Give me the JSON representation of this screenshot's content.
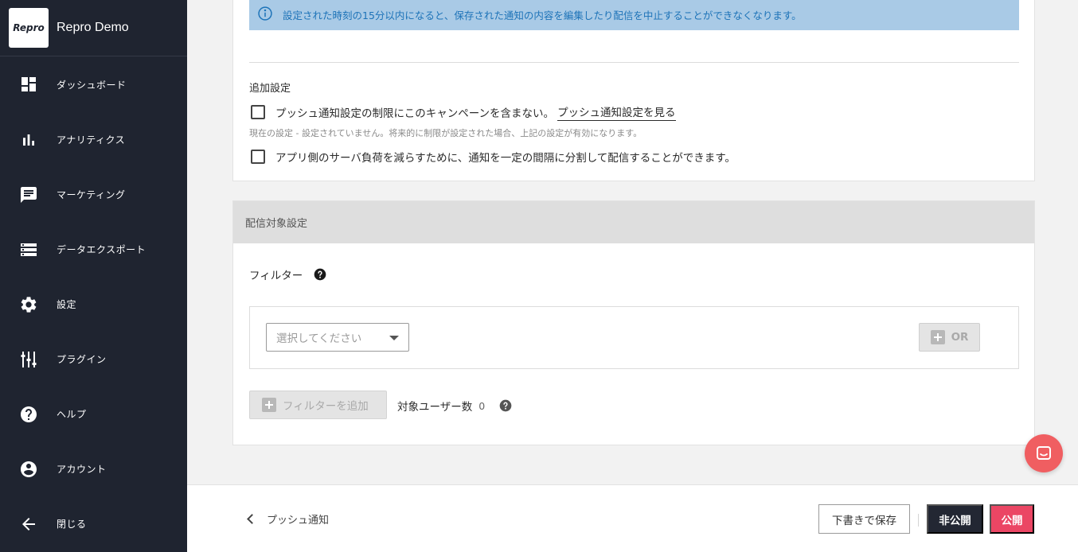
{
  "app": {
    "logo_text": "Repro",
    "name": "Repro Demo"
  },
  "sidebar": {
    "items": [
      {
        "label": "ダッシュボード",
        "icon": "dashboard-icon"
      },
      {
        "label": "アナリティクス",
        "icon": "bar-chart-icon"
      },
      {
        "label": "マーケティング",
        "icon": "message-icon"
      },
      {
        "label": "データエクスポート",
        "icon": "storage-icon"
      },
      {
        "label": "設定",
        "icon": "gear-icon"
      },
      {
        "label": "プラグイン",
        "icon": "plugin-icon"
      },
      {
        "label": "ヘルプ",
        "icon": "help-icon"
      },
      {
        "label": "アカウント",
        "icon": "account-icon"
      },
      {
        "label": "閉じる",
        "icon": "arrow-left-icon"
      }
    ]
  },
  "notice": {
    "text": "設定された時刻の15分以内になると、保存された通知の内容を編集したり配信を中止することができなくなります。",
    "color": "#1d73b8",
    "bg": "#a9cae6"
  },
  "additional": {
    "title": "追加設定",
    "option1_label": "プッシュ通知設定の制限にこのキャンペーンを含まない。",
    "option1_link": "プッシュ通知設定を見る",
    "note": "現在の設定 - 設定されていません。将来的に制限が設定された場合、上記の設定が有効になります。",
    "option2_label": "アプリ側のサーバ負荷を減らすために、通知を一定の間隔に分割して配信することができます。"
  },
  "targeting": {
    "title": "配信対象設定",
    "filter_label": "フィルター",
    "select_placeholder": "選択してください",
    "or_label": "OR",
    "add_filter_label": "フィルターを追加",
    "target_users_label": "対象ユーザー数",
    "target_users_count": "0"
  },
  "footer": {
    "back_label": "プッシュ通知",
    "save_draft_label": "下書きで保存",
    "private_label": "非公開",
    "publish_label": "公開",
    "publish_color": "#eb4664"
  }
}
